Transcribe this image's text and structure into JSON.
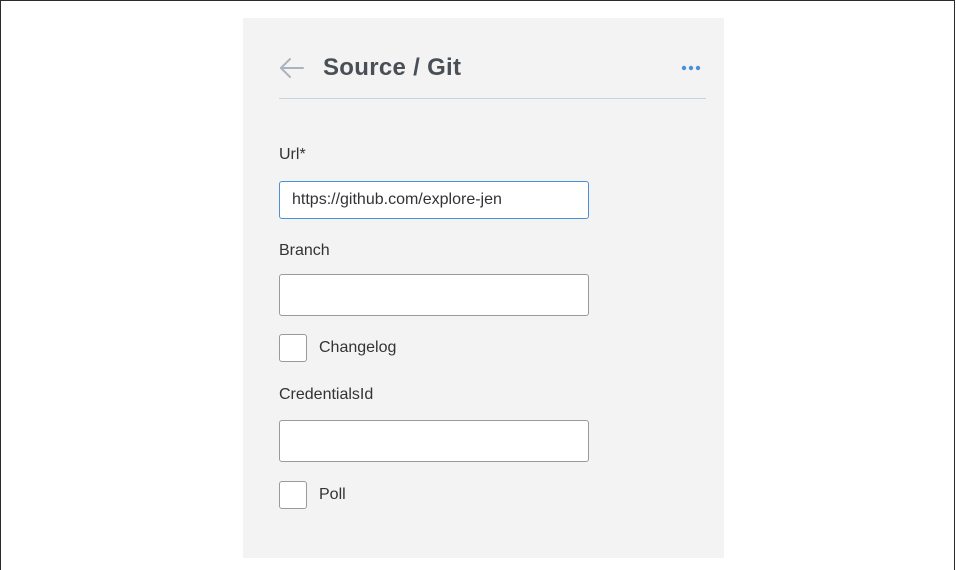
{
  "header": {
    "title": "Source / Git",
    "back_icon": "arrow-left-icon",
    "more_icon": "more-horizontal-icon"
  },
  "form": {
    "url": {
      "label": "Url*",
      "value": "https://github.com/explore-jen"
    },
    "branch": {
      "label": "Branch",
      "value": ""
    },
    "changelog": {
      "label": "Changelog",
      "checked": false
    },
    "credentials": {
      "label": "CredentialsId",
      "value": ""
    },
    "poll": {
      "label": "Poll",
      "checked": false
    }
  },
  "colors": {
    "panel_background": "#f3f3f3",
    "accent": "#4a90d9",
    "title": "#4a4f55"
  }
}
